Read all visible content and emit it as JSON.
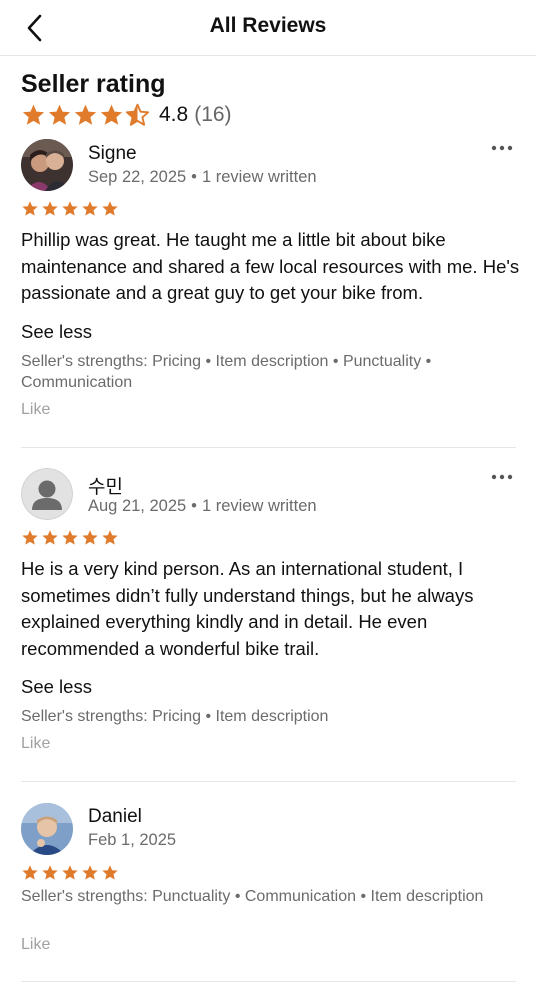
{
  "header": {
    "title": "All Reviews",
    "back_icon": "chevron-left-icon"
  },
  "seller_rating": {
    "title": "Seller rating",
    "stars": 4.5,
    "value": "4.8",
    "count": "(16)",
    "star_color": "#E07B2C"
  },
  "reviews": [
    {
      "name": "Signe",
      "date": "Sep 22, 2025",
      "separator": "•",
      "written": "1 review written",
      "stars": 5,
      "text": "Phillip was great. He taught me a little bit about bike maintenance and shared a few local resources with me. He's passionate and a great guy to get your bike from.",
      "see_less": "See less",
      "strengths": "Seller's strengths: Pricing • Item description • Punctuality • Communication",
      "like": "Like"
    },
    {
      "name": "수민",
      "date": "Aug 21, 2025",
      "separator": "•",
      "written": "1 review written",
      "stars": 5,
      "text": "He is a very kind person. As an international student, I sometimes didn’t fully understand things, but he always explained everything kindly and in detail. He even recommended a wonderful bike trail.",
      "see_less": "See less",
      "strengths": "Seller's strengths: Pricing • Item description",
      "like": "Like"
    },
    {
      "name": "Daniel",
      "date": "Feb 1, 2025",
      "stars": 5,
      "strengths": "Seller's strengths: Punctuality • Communication • Item description",
      "like": "Like"
    }
  ]
}
